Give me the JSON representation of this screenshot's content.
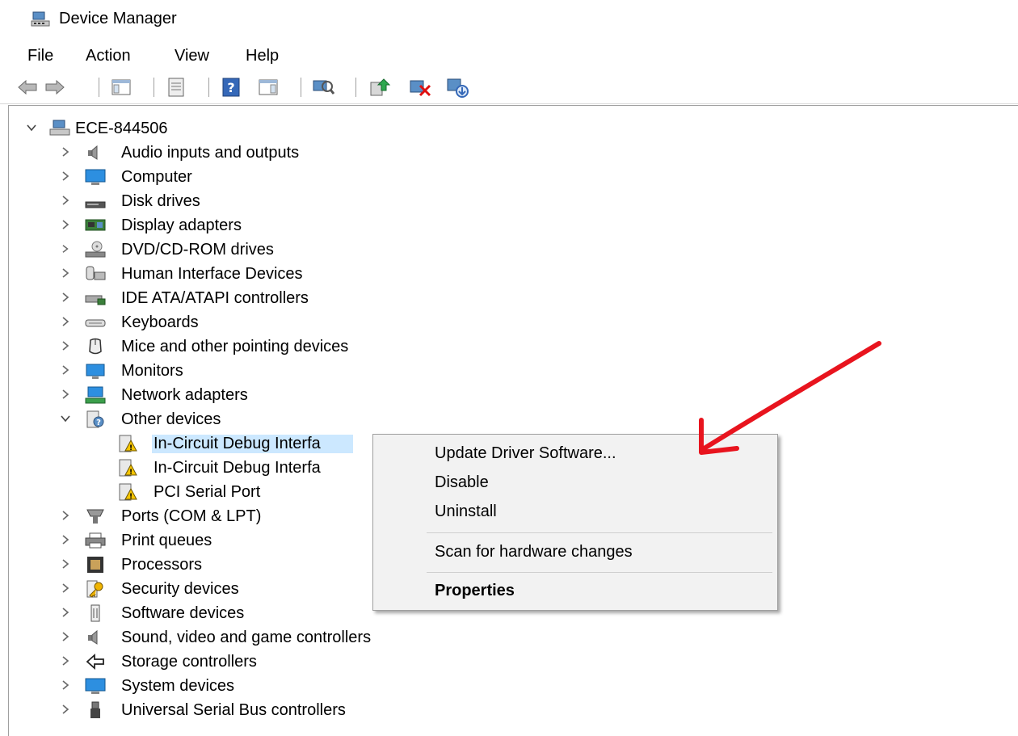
{
  "window": {
    "title": "Device Manager",
    "icon": "device-manager-icon"
  },
  "menu": {
    "items": [
      "File",
      "Action",
      "View",
      "Help"
    ]
  },
  "toolbar": {
    "buttons": [
      "back-arrow-icon",
      "forward-arrow-icon",
      "show-hide-console-tree-icon",
      "properties-icon",
      "help-icon",
      "show-action-pane-icon",
      "scan-hardware-icon",
      "update-driver-icon",
      "uninstall-device-icon",
      "add-legacy-hardware-icon"
    ]
  },
  "tree": {
    "root": {
      "label": "ECE-844506",
      "icon": "computer-root-icon",
      "expanded": true
    },
    "categories": [
      {
        "label": "Audio inputs and outputs",
        "icon": "speaker-icon"
      },
      {
        "label": "Computer",
        "icon": "monitor-icon"
      },
      {
        "label": "Disk drives",
        "icon": "disk-drive-icon"
      },
      {
        "label": "Display adapters",
        "icon": "display-adapter-icon"
      },
      {
        "label": "DVD/CD-ROM drives",
        "icon": "dvd-drive-icon"
      },
      {
        "label": "Human Interface Devices",
        "icon": "hid-icon"
      },
      {
        "label": "IDE ATA/ATAPI controllers",
        "icon": "ide-controller-icon"
      },
      {
        "label": "Keyboards",
        "icon": "keyboard-icon"
      },
      {
        "label": "Mice and other pointing devices",
        "icon": "mouse-icon"
      },
      {
        "label": "Monitors",
        "icon": "monitor-icon"
      },
      {
        "label": "Network adapters",
        "icon": "network-adapter-icon"
      },
      {
        "label": "Other devices",
        "icon": "unknown-device-icon",
        "expanded": true,
        "children": [
          {
            "label": "In-Circuit Debug Interfa",
            "icon": "warning-device-icon",
            "selected": true
          },
          {
            "label": "In-Circuit Debug Interfa",
            "icon": "warning-device-icon"
          },
          {
            "label": "PCI Serial Port",
            "icon": "warning-device-icon"
          }
        ]
      },
      {
        "label": "Ports (COM & LPT)",
        "icon": "port-icon"
      },
      {
        "label": "Print queues",
        "icon": "printer-icon"
      },
      {
        "label": "Processors",
        "icon": "processor-icon"
      },
      {
        "label": "Security devices",
        "icon": "security-key-icon"
      },
      {
        "label": "Software devices",
        "icon": "software-device-icon"
      },
      {
        "label": "Sound, video and game controllers",
        "icon": "speaker-icon"
      },
      {
        "label": "Storage controllers",
        "icon": "storage-controller-icon"
      },
      {
        "label": "System devices",
        "icon": "system-device-icon"
      },
      {
        "label": "Universal Serial Bus controllers",
        "icon": "usb-icon"
      }
    ]
  },
  "context_menu": {
    "items": [
      {
        "label": "Update Driver Software...",
        "bold": false
      },
      {
        "label": "Disable",
        "bold": false
      },
      {
        "label": "Uninstall",
        "bold": false
      },
      {
        "label": "Scan for hardware changes",
        "bold": false
      },
      {
        "label": "Properties",
        "bold": true
      }
    ]
  },
  "annotation": {
    "arrow_color": "#e8141e"
  }
}
